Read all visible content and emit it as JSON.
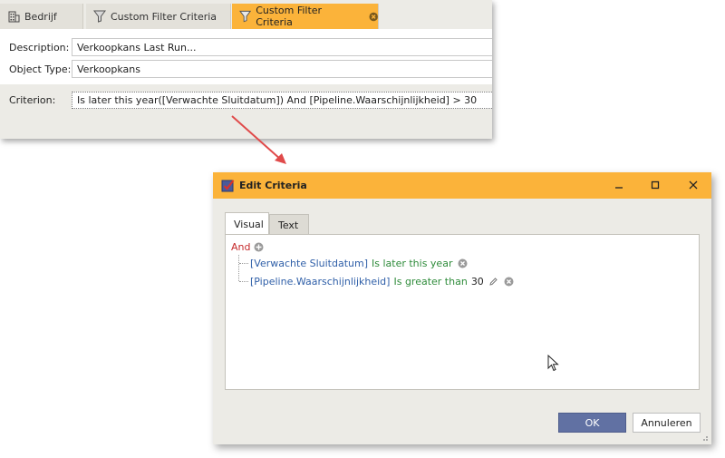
{
  "top_panel": {
    "tabs": [
      {
        "label": "Bedrijf",
        "icon": "building-icon"
      },
      {
        "label": "Custom Filter Criteria",
        "icon": "filter-icon"
      },
      {
        "label": "Custom Filter Criteria",
        "icon": "filter-icon",
        "active": true
      }
    ],
    "description": {
      "label": "Description:",
      "value": "Verkoopkans Last Run..."
    },
    "object_type": {
      "label": "Object Type:",
      "value": "Verkoopkans"
    },
    "criterion": {
      "label": "Criterion:",
      "value": "Is later this year([Verwachte Sluitdatum]) And [Pipeline.Waarschijnlijkheid] > 30"
    }
  },
  "dialog": {
    "title": "Edit Criteria",
    "tabs": [
      {
        "label": "Visual",
        "selected": true
      },
      {
        "label": "Text",
        "selected": false
      }
    ],
    "tree": {
      "root_operator": "And",
      "conditions": [
        {
          "field": "[Verwachte Sluitdatum]",
          "operator": "Is later this year",
          "value": ""
        },
        {
          "field": "[Pipeline.Waarschijnlijkheid]",
          "operator": "Is greater than",
          "value": "30"
        }
      ]
    },
    "ok_label": "OK",
    "cancel_label": "Annuleren"
  },
  "colors": {
    "accent": "#fbb33a",
    "ok_button": "#6171a3",
    "and_operator": "#c5292a",
    "field": "#2f5fa8",
    "operator": "#2e8b3a",
    "arrow": "#e04a4a"
  }
}
